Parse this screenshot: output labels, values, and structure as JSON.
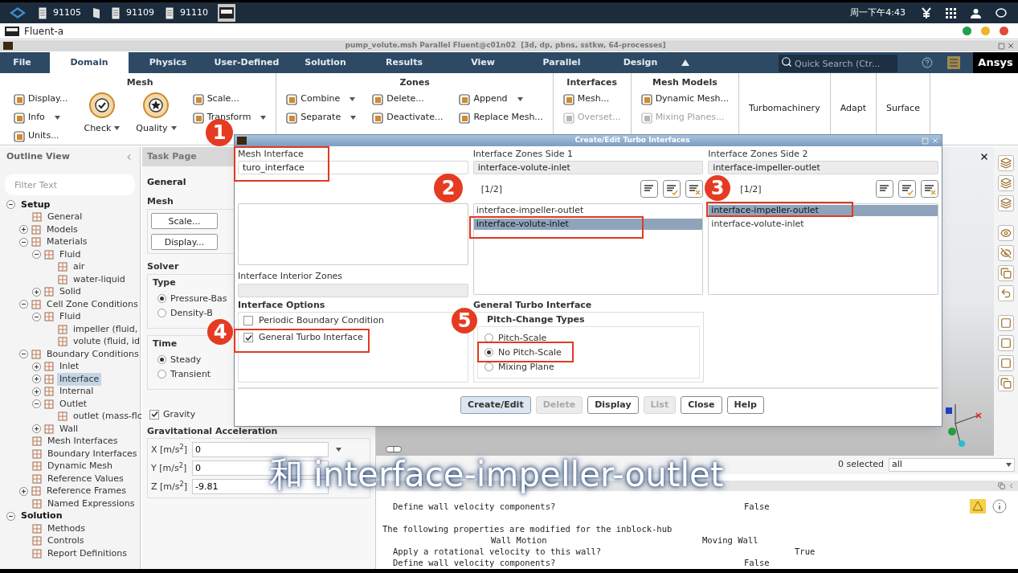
{
  "taskbar": {
    "apps": [
      {
        "kind": "document",
        "label": "91105",
        "selected": false
      },
      {
        "kind": "book",
        "selected": false
      },
      {
        "kind": "document",
        "label": "91109",
        "selected": false
      },
      {
        "kind": "document",
        "label": "91110",
        "selected": false
      },
      {
        "kind": "ansys",
        "selected": true
      }
    ],
    "clock": "周一下午4:43"
  },
  "app_window": {
    "title": "Fluent-a"
  },
  "fluent_title": "pump_volute.msh Parallel Fluent@c01n02  [3d, dp, pbns, sstkw, 64-processes]",
  "ribbon": {
    "tabs": [
      {
        "label": "File",
        "selected": false
      },
      {
        "label": "Domain",
        "selected": true
      },
      {
        "label": "Physics",
        "selected": false
      },
      {
        "label": "User-Defined",
        "selected": false
      },
      {
        "label": "Solution",
        "selected": false
      },
      {
        "label": "Results",
        "selected": false
      },
      {
        "label": "View",
        "selected": false
      },
      {
        "label": "Parallel",
        "selected": false
      },
      {
        "label": "Design",
        "selected": false
      }
    ],
    "search_placeholder": "Quick Search (Ctr...",
    "logo": "Ansys",
    "groups": [
      {
        "kind": "tools",
        "title": "Mesh",
        "columns": [
          [
            {
              "kind": "small",
              "label": "Display..."
            },
            {
              "kind": "small",
              "label": "Info",
              "dropdown": true
            }
          ],
          [
            {
              "kind": "large",
              "label": "Check",
              "dropdown": true
            }
          ],
          [
            {
              "kind": "large",
              "label": "Quality",
              "dropdown": true
            }
          ],
          [
            {
              "kind": "small",
              "label": "Scale..."
            },
            {
              "kind": "small",
              "label": "Transform",
              "dropdown": true
            }
          ]
        ]
      },
      {
        "kind": "tools",
        "title": "Zones",
        "columns": [
          [
            {
              "kind": "small",
              "label": "Combine",
              "dropdown": true
            },
            {
              "kind": "small",
              "label": "Separate",
              "dropdown": true
            }
          ],
          [
            {
              "kind": "small",
              "label": "Delete..."
            },
            {
              "kind": "small",
              "label": "Deactivate..."
            }
          ],
          [
            {
              "kind": "small",
              "label": "Append",
              "dropdown": true
            },
            {
              "kind": "small",
              "label": "Replace Mesh..."
            }
          ]
        ]
      },
      {
        "kind": "tools",
        "title": "Interfaces",
        "columns": [
          [
            {
              "kind": "small",
              "label": "Mesh..."
            },
            {
              "kind": "small",
              "label": "Overset...",
              "disabled": true
            }
          ]
        ]
      },
      {
        "kind": "tools",
        "title": "Mesh Models",
        "columns": [
          [
            {
              "kind": "small",
              "label": "Dynamic Mesh..."
            },
            {
              "kind": "small",
              "label": "Mixing Planes...",
              "disabled": true
            }
          ]
        ]
      },
      {
        "kind": "single",
        "title": "Turbomachinery"
      },
      {
        "kind": "single",
        "title": "Adapt"
      },
      {
        "kind": "single",
        "title": "Surface"
      }
    ],
    "units_label": "Units..."
  },
  "outline": {
    "title": "Outline View",
    "filter_placeholder": "Filter Text",
    "tree": [
      {
        "label": "Setup",
        "expanded": true,
        "selected": false,
        "children": [
          {
            "label": "General",
            "selected": false
          },
          {
            "label": "Models",
            "expanded": false,
            "selected": false
          },
          {
            "label": "Materials",
            "expanded": true,
            "selected": false,
            "children": [
              {
                "label": "Fluid",
                "expanded": true,
                "selected": false,
                "children": [
                  {
                    "label": "air",
                    "selected": false
                  },
                  {
                    "label": "water-liquid",
                    "selected": false
                  }
                ]
              },
              {
                "label": "Solid",
                "expanded": false,
                "selected": false
              }
            ]
          },
          {
            "label": "Cell Zone Conditions",
            "expanded": true,
            "selected": false,
            "children": [
              {
                "label": "Fluid",
                "expanded": true,
                "selected": false,
                "children": [
                  {
                    "label": "impeller (fluid,",
                    "selected": false
                  },
                  {
                    "label": "volute (fluid, id",
                    "selected": false
                  }
                ]
              }
            ]
          },
          {
            "label": "Boundary Conditions",
            "expanded": true,
            "selected": false,
            "children": [
              {
                "label": "Inlet",
                "expanded": false,
                "selected": false
              },
              {
                "label": "Interface",
                "expanded": false,
                "selected": true
              },
              {
                "label": "Internal",
                "expanded": false,
                "selected": false
              },
              {
                "label": "Outlet",
                "expanded": true,
                "selected": false,
                "children": [
                  {
                    "label": "outlet (mass-flc",
                    "selected": false
                  }
                ]
              },
              {
                "label": "Wall",
                "expanded": false,
                "selected": false
              }
            ]
          },
          {
            "label": "Mesh Interfaces",
            "selected": false
          },
          {
            "label": "Boundary Interfaces",
            "selected": false
          },
          {
            "label": "Dynamic Mesh",
            "selected": false
          },
          {
            "label": "Reference Values",
            "selected": false
          },
          {
            "label": "Reference Frames",
            "expanded": false,
            "selected": false
          },
          {
            "label": "Named Expressions",
            "selected": false
          }
        ]
      },
      {
        "label": "Solution",
        "expanded": true,
        "selected": false,
        "children": [
          {
            "label": "Methods",
            "selected": false
          },
          {
            "label": "Controls",
            "selected": false
          },
          {
            "label": "Report Definitions",
            "selected": false
          }
        ]
      }
    ]
  },
  "task_page": {
    "title": "Task Page",
    "heading": "General",
    "mesh_title": "Mesh",
    "mesh_buttons": [
      "Scale...",
      "Display..."
    ],
    "solver_title": "Solver",
    "type": {
      "title": "Type",
      "options": [
        {
          "label": "Pressure-Bas",
          "selected": true
        },
        {
          "label": "Density-B",
          "selected": false
        }
      ]
    },
    "time": {
      "title": "Time",
      "options": [
        {
          "label": "Steady",
          "selected": true
        },
        {
          "label": "Transient",
          "selected": false
        }
      ]
    },
    "gravity": {
      "label": "Gravity",
      "checked": true
    },
    "acceleration": {
      "title": "Gravitational Acceleration",
      "fields": [
        {
          "label": "X [m/s$^{2}$]",
          "value": "0"
        },
        {
          "label": "Y [m/s$^{2}$]",
          "value": "0"
        },
        {
          "label": "Z [m/s$^{2}$]",
          "value": "-9.81"
        }
      ]
    }
  },
  "dialog": {
    "title": "Create/Edit Turbo Interfaces",
    "mesh_interface": {
      "label": "Mesh Interface",
      "value": "turo_interface"
    },
    "interior_zones": {
      "label": "Interface Interior Zones"
    },
    "side1": {
      "label": "Interface Zones Side 1",
      "value": "interface-volute-inlet",
      "count": "[1/2]",
      "items": [
        {
          "label": "interface-impeller-outlet",
          "selected": false
        },
        {
          "label": "interface-volute-inlet",
          "selected": true
        }
      ]
    },
    "side2": {
      "label": "Interface Zones Side 2",
      "value": "interface-impeller-outlet",
      "count": "[1/2]",
      "items": [
        {
          "label": "interface-impeller-outlet",
          "selected": true
        },
        {
          "label": "interface-volute-inlet",
          "selected": false
        }
      ]
    },
    "options": {
      "title": "Interface Options",
      "checkboxes": [
        {
          "label": "Periodic Boundary Condition",
          "checked": false
        },
        {
          "label": "General Turbo Interface",
          "checked": true
        }
      ]
    },
    "turbo": {
      "title": "General Turbo Interface",
      "subtitle": "Pitch-Change Types",
      "options": [
        {
          "label": "Pitch-Scale",
          "selected": false
        },
        {
          "label": "No Pitch-Scale",
          "selected": true
        },
        {
          "label": "Mixing Plane",
          "selected": false
        }
      ]
    },
    "buttons": [
      {
        "label": "Create/Edit",
        "disabled": false,
        "primary": true
      },
      {
        "label": "Delete",
        "disabled": true,
        "primary": false
      },
      {
        "label": "Display",
        "disabled": false,
        "primary": false
      },
      {
        "label": "List",
        "disabled": true,
        "primary": false
      },
      {
        "label": "Close",
        "disabled": false,
        "primary": false
      },
      {
        "label": "Help",
        "disabled": false,
        "primary": false
      }
    ]
  },
  "annotations": [
    "1",
    "2",
    "3",
    "4",
    "5"
  ],
  "selection": {
    "count": "0 selected",
    "filter": "all"
  },
  "console": {
    "lines": [
      {
        "kind": "property",
        "name": "Define wall velocity components?",
        "value": "False"
      },
      {
        "kind": "message",
        "text": "The following properties are modified for the inblock-hub"
      },
      {
        "kind": "motion",
        "name": "Wall Motion",
        "value": "Moving Wall"
      },
      {
        "kind": "property",
        "name": "Apply a rotational velocity to this wall?",
        "value": "True"
      },
      {
        "kind": "property",
        "name": "Define wall velocity components?",
        "value": "False"
      }
    ]
  },
  "caption": "和 interface-impeller-outlet"
}
